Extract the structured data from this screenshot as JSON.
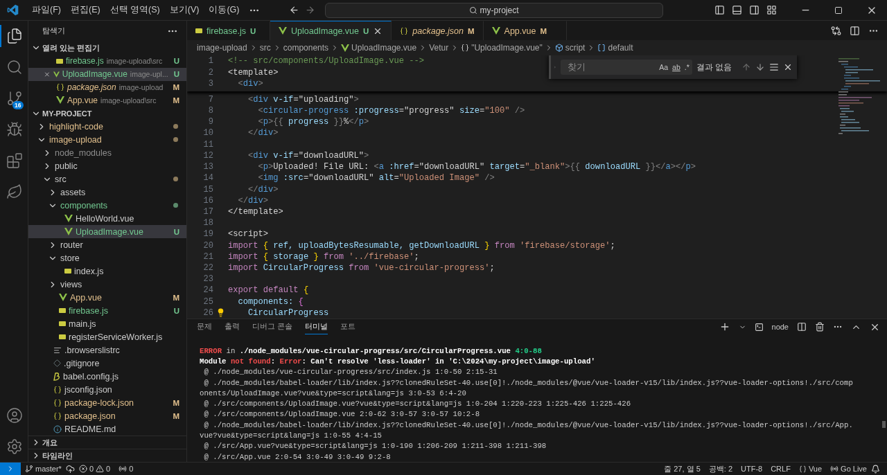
{
  "title_bar": {
    "menu": [
      "파일(F)",
      "편집(E)",
      "선택 영역(S)",
      "보기(V)",
      "이동(G)"
    ],
    "command_center": "my-project"
  },
  "activity_bar": {
    "top": [
      {
        "kind": "explorer",
        "selected": true
      },
      {
        "kind": "search",
        "selected": false
      },
      {
        "kind": "scm",
        "selected": false,
        "badge": "16"
      },
      {
        "kind": "debug",
        "selected": false
      },
      {
        "kind": "extensions",
        "selected": false
      },
      {
        "kind": "leaf",
        "selected": false
      }
    ],
    "bottom": [
      {
        "kind": "account",
        "selected": false
      },
      {
        "kind": "settings",
        "selected": false
      }
    ]
  },
  "sidebar": {
    "title": "탐색기",
    "open_editors": {
      "title": "열려 있는 편집기",
      "expanded": true,
      "items": [
        {
          "name": "firebase.js",
          "path": "image-upload\\src",
          "kind": "js",
          "color": "#73c991",
          "badge": "U",
          "selected": false,
          "preview": false
        },
        {
          "name": "UploadImage.vue",
          "path": "image-upl...",
          "kind": "vue",
          "color": "#73c991",
          "badge": "U",
          "selected": true,
          "preview": false
        },
        {
          "name": "package.json",
          "path": "image-upload",
          "kind": "json",
          "color": "#e2c08d",
          "badge": "M",
          "selected": false,
          "preview": true
        },
        {
          "name": "App.vue",
          "path": "image-upload\\src",
          "kind": "vue",
          "color": "#e2c08d",
          "badge": "M",
          "selected": false,
          "preview": false
        }
      ]
    },
    "project": {
      "title": "MY-PROJECT",
      "expanded": true,
      "items": [
        {
          "name": "highlight-code",
          "kind": "folder",
          "color": "#e2c08d",
          "expanded": false,
          "selected": false,
          "dot": {
            "color": "#8c7a5b"
          }
        },
        {
          "name": "image-upload",
          "kind": "folder",
          "color": "#e2c08d",
          "expanded": true,
          "selected": false,
          "dot": {
            "color": "#8c7a5b"
          },
          "children": [
            {
              "name": "node_modules",
              "kind": "folder",
              "color": "#8c8c8c",
              "expanded": false,
              "selected": false
            },
            {
              "name": "public",
              "kind": "folder",
              "color": "#cccccc",
              "expanded": false,
              "selected": false
            },
            {
              "name": "src",
              "kind": "folder",
              "color": "#cccccc",
              "expanded": true,
              "selected": false,
              "dot": {
                "color": "#8c7a5b"
              },
              "children": [
                {
                  "name": "assets",
                  "kind": "folder",
                  "color": "#cccccc",
                  "expanded": false,
                  "selected": false
                },
                {
                  "name": "components",
                  "kind": "folder",
                  "color": "#73c991",
                  "expanded": true,
                  "selected": false,
                  "dot": {
                    "color": "#5b8a6b"
                  },
                  "children": [
                    {
                      "name": "HelloWorld.vue",
                      "kind": "vue",
                      "color": "#cccccc",
                      "selected": false
                    },
                    {
                      "name": "UploadImage.vue",
                      "kind": "vue",
                      "color": "#73c991",
                      "badge": "U",
                      "selected": true
                    }
                  ]
                },
                {
                  "name": "router",
                  "kind": "folder",
                  "color": "#cccccc",
                  "expanded": false,
                  "selected": false
                },
                {
                  "name": "store",
                  "kind": "folder",
                  "color": "#cccccc",
                  "expanded": true,
                  "selected": false,
                  "children": [
                    {
                      "name": "index.js",
                      "kind": "js",
                      "color": "#cccccc",
                      "selected": false
                    }
                  ]
                },
                {
                  "name": "views",
                  "kind": "folder",
                  "color": "#cccccc",
                  "expanded": false,
                  "selected": false
                },
                {
                  "name": "App.vue",
                  "kind": "vue",
                  "color": "#e2c08d",
                  "badge": "M",
                  "selected": false
                },
                {
                  "name": "firebase.js",
                  "kind": "js",
                  "color": "#73c991",
                  "badge": "U",
                  "selected": false
                },
                {
                  "name": "main.js",
                  "kind": "js",
                  "color": "#cccccc",
                  "selected": false
                },
                {
                  "name": "registerServiceWorker.js",
                  "kind": "js",
                  "color": "#cccccc",
                  "selected": false
                }
              ]
            },
            {
              "name": ".browserslistrc",
              "kind": "list",
              "color": "#cccccc",
              "selected": false
            },
            {
              "name": ".gitignore",
              "kind": "git",
              "color": "#cccccc",
              "selected": false
            },
            {
              "name": "babel.config.js",
              "kind": "babel",
              "color": "#cccccc",
              "selected": false
            },
            {
              "name": "jsconfig.json",
              "kind": "json",
              "color": "#cccccc",
              "selected": false
            },
            {
              "name": "package-lock.json",
              "kind": "json",
              "color": "#e2c08d",
              "badge": "M",
              "selected": false
            },
            {
              "name": "package.json",
              "kind": "json",
              "color": "#e2c08d",
              "badge": "M",
              "selected": false
            },
            {
              "name": "README.md",
              "kind": "info",
              "color": "#cccccc",
              "selected": false
            }
          ]
        }
      ]
    },
    "collapsed_sections": [
      {
        "title": "개요",
        "expanded": false
      },
      {
        "title": "타임라인",
        "expanded": false
      }
    ]
  },
  "editor": {
    "tabs": [
      {
        "label": "firebase.js",
        "kind": "js",
        "color": "#73c991",
        "badge": "U",
        "selected": false,
        "preview": false
      },
      {
        "label": "UploadImage.vue",
        "kind": "vue",
        "color": "#73c991",
        "badge": "U",
        "selected": true,
        "preview": false
      },
      {
        "label": "package.json",
        "kind": "json",
        "color": "#e2c08d",
        "badge": "M",
        "selected": false,
        "preview": true
      },
      {
        "label": "App.vue",
        "kind": "vue",
        "color": "#e2c08d",
        "badge": "M",
        "selected": false,
        "preview": false
      }
    ],
    "breadcrumb": [
      {
        "label": "image-upload",
        "kind": "text"
      },
      {
        "label": "src",
        "kind": "text"
      },
      {
        "label": "components",
        "kind": "text"
      },
      {
        "label": "UploadImage.vue",
        "kind": "vue"
      },
      {
        "label": "Vetur",
        "kind": "text"
      },
      {
        "label": "\"UploadImage.vue\"",
        "kind": "braces"
      },
      {
        "label": "script",
        "kind": "module"
      },
      {
        "label": "default",
        "kind": "field"
      }
    ],
    "find": {
      "placeholder": "찾기",
      "options": [
        "Aa",
        "ab",
        ".*"
      ],
      "result": "결과 없음"
    },
    "sticky_lines": [
      {
        "number": "1",
        "tokens": [
          {
            "text": "<!-- src/components/UploadImage.vue -->",
            "kind": "comment"
          }
        ]
      },
      {
        "number": "2",
        "tokens": [
          {
            "text": "<template>",
            "kind": "text"
          }
        ]
      },
      {
        "number": "3",
        "tokens": [
          {
            "text": "  <",
            "kind": "punct"
          },
          {
            "text": "div",
            "kind": "tag"
          },
          {
            "text": ">",
            "kind": "punct"
          }
        ]
      }
    ],
    "lines": [
      {
        "number": "7",
        "tokens": [
          {
            "text": "    <",
            "kind": "punct"
          },
          {
            "text": "div",
            "kind": "tag"
          },
          {
            "text": " v-if",
            "kind": "attr"
          },
          {
            "text": "=\"uploading\"",
            "kind": "text"
          },
          {
            "text": ">",
            "kind": "punct"
          }
        ]
      },
      {
        "number": "8",
        "tokens": [
          {
            "text": "      <",
            "kind": "punct"
          },
          {
            "text": "circular-progress",
            "kind": "tag"
          },
          {
            "text": " :progress",
            "kind": "attr"
          },
          {
            "text": "=\"progress\"",
            "kind": "text"
          },
          {
            "text": " size",
            "kind": "attr"
          },
          {
            "text": "=",
            "kind": "text"
          },
          {
            "text": "\"100\"",
            "kind": "str"
          },
          {
            "text": " />",
            "kind": "punct"
          }
        ]
      },
      {
        "number": "9",
        "tokens": [
          {
            "text": "      <",
            "kind": "punct"
          },
          {
            "text": "p",
            "kind": "tag"
          },
          {
            "text": ">{{ ",
            "kind": "punct"
          },
          {
            "text": "progress",
            "kind": "var"
          },
          {
            "text": " }}",
            "kind": "punct"
          },
          {
            "text": "%",
            "kind": "text"
          },
          {
            "text": "</",
            "kind": "punct"
          },
          {
            "text": "p",
            "kind": "tag"
          },
          {
            "text": ">",
            "kind": "punct"
          }
        ]
      },
      {
        "number": "10",
        "tokens": [
          {
            "text": "    </",
            "kind": "punct"
          },
          {
            "text": "div",
            "kind": "tag"
          },
          {
            "text": ">",
            "kind": "punct"
          }
        ]
      },
      {
        "number": "11"
      },
      {
        "number": "12",
        "tokens": [
          {
            "text": "    <",
            "kind": "punct"
          },
          {
            "text": "div",
            "kind": "tag"
          },
          {
            "text": " v-if",
            "kind": "attr"
          },
          {
            "text": "=\"downloadURL\"",
            "kind": "text"
          },
          {
            "text": ">",
            "kind": "punct"
          }
        ]
      },
      {
        "number": "13",
        "tokens": [
          {
            "text": "      <",
            "kind": "punct"
          },
          {
            "text": "p",
            "kind": "tag"
          },
          {
            "text": ">",
            "kind": "punct"
          },
          {
            "text": "Uploaded! File URL: ",
            "kind": "text"
          },
          {
            "text": "<",
            "kind": "punct"
          },
          {
            "text": "a",
            "kind": "tag"
          },
          {
            "text": " :href",
            "kind": "attr"
          },
          {
            "text": "=\"downloadURL\"",
            "kind": "text"
          },
          {
            "text": " target",
            "kind": "attr"
          },
          {
            "text": "=",
            "kind": "text"
          },
          {
            "text": "\"_blank\"",
            "kind": "str"
          },
          {
            "text": ">{{ ",
            "kind": "punct"
          },
          {
            "text": "downloadURL",
            "kind": "var"
          },
          {
            "text": " }}</",
            "kind": "punct"
          },
          {
            "text": "a",
            "kind": "tag"
          },
          {
            "text": "></",
            "kind": "punct"
          },
          {
            "text": "p",
            "kind": "tag"
          },
          {
            "text": ">",
            "kind": "punct"
          }
        ]
      },
      {
        "number": "14",
        "tokens": [
          {
            "text": "      <",
            "kind": "punct"
          },
          {
            "text": "img",
            "kind": "tag"
          },
          {
            "text": " :src",
            "kind": "attr"
          },
          {
            "text": "=\"downloadURL\"",
            "kind": "text"
          },
          {
            "text": " alt",
            "kind": "attr"
          },
          {
            "text": "=",
            "kind": "text"
          },
          {
            "text": "\"Uploaded Image\"",
            "kind": "str"
          },
          {
            "text": " />",
            "kind": "punct"
          }
        ]
      },
      {
        "number": "15",
        "tokens": [
          {
            "text": "    </",
            "kind": "punct"
          },
          {
            "text": "div",
            "kind": "tag"
          },
          {
            "text": ">",
            "kind": "punct"
          }
        ]
      },
      {
        "number": "16",
        "tokens": [
          {
            "text": "  </",
            "kind": "punct"
          },
          {
            "text": "div",
            "kind": "tag"
          },
          {
            "text": ">",
            "kind": "punct"
          }
        ]
      },
      {
        "number": "17",
        "tokens": [
          {
            "text": "</template>",
            "kind": "text"
          }
        ]
      },
      {
        "number": "18"
      },
      {
        "number": "19",
        "tokens": [
          {
            "text": "<script>",
            "kind": "text"
          }
        ]
      },
      {
        "number": "20",
        "tokens": [
          {
            "text": "import ",
            "kind": "kw"
          },
          {
            "text": "{",
            "kind": "b1"
          },
          {
            "text": " ref, uploadBytesResumable, getDownloadURL ",
            "kind": "var"
          },
          {
            "text": "}",
            "kind": "b1"
          },
          {
            "text": " from ",
            "kind": "kw"
          },
          {
            "text": "'firebase/storage'",
            "kind": "str"
          },
          {
            "text": ";",
            "kind": "text"
          }
        ]
      },
      {
        "number": "21",
        "tokens": [
          {
            "text": "import ",
            "kind": "kw"
          },
          {
            "text": "{",
            "kind": "b1"
          },
          {
            "text": " storage ",
            "kind": "var"
          },
          {
            "text": "}",
            "kind": "b1"
          },
          {
            "text": " from ",
            "kind": "kw"
          },
          {
            "text": "'../firebase'",
            "kind": "str"
          },
          {
            "text": ";",
            "kind": "text"
          }
        ]
      },
      {
        "number": "22",
        "tokens": [
          {
            "text": "import ",
            "kind": "kw"
          },
          {
            "text": "CircularProgress ",
            "kind": "var"
          },
          {
            "text": "from ",
            "kind": "kw"
          },
          {
            "text": "'vue-circular-progress'",
            "kind": "str"
          },
          {
            "text": ";",
            "kind": "text"
          }
        ]
      },
      {
        "number": "23"
      },
      {
        "number": "24",
        "tokens": [
          {
            "text": "export default ",
            "kind": "kw"
          },
          {
            "text": "{",
            "kind": "b1"
          }
        ]
      },
      {
        "number": "25",
        "tokens": [
          {
            "text": "  components: ",
            "kind": "var"
          },
          {
            "text": "{",
            "kind": "b2"
          }
        ]
      },
      {
        "number": "26",
        "bulb": true,
        "tokens": [
          {
            "text": "    CircularProgress",
            "kind": "var"
          }
        ]
      }
    ]
  },
  "panel": {
    "tabs": [
      {
        "label": "문제",
        "selected": false
      },
      {
        "label": "출력",
        "selected": false
      },
      {
        "label": "디버그 콘솔",
        "selected": false
      },
      {
        "label": "터미널",
        "selected": true
      },
      {
        "label": "포트",
        "selected": false
      }
    ],
    "terminal_name": "node",
    "lines": [
      [
        {
          "text": "ERROR",
          "kind": "err"
        },
        {
          "text": " in ",
          "kind": "text"
        },
        {
          "text": "./node_modules/vue-circular-progress/src/CircularProgress.vue",
          "kind": "bold"
        },
        {
          "text": " 4:0-88",
          "kind": "ok"
        }
      ],
      [
        {
          "text": "Module ",
          "kind": "bold"
        },
        {
          "text": "not found",
          "kind": "err"
        },
        {
          "text": ": ",
          "kind": "bold"
        },
        {
          "text": "Error",
          "kind": "err"
        },
        {
          "text": ": Can't resolve 'less-loader' in 'C:\\2024\\my-project\\image-upload'",
          "kind": "bold"
        }
      ],
      [
        {
          "text": " @ ./node_modules/vue-circular-progress/src/index.js 1:0-50 2:15-31",
          "kind": "text"
        }
      ],
      [
        {
          "text": " @ ./node_modules/babel-loader/lib/index.js??clonedRuleSet-40.use[0]!./node_modules/@vue/vue-loader-v15/lib/index.js??vue-loader-options!./src/comp",
          "kind": "text"
        }
      ],
      [
        {
          "text": "onents/UploadImage.vue?vue&type=script&lang=js 3:0-53 6:4-20",
          "kind": "text"
        }
      ],
      [
        {
          "text": " @ ./src/components/UploadImage.vue?vue&type=script&lang=js 1:0-204 1:220-223 1:225-426 1:225-426",
          "kind": "text"
        }
      ],
      [
        {
          "text": " @ ./src/components/UploadImage.vue 2:0-62 3:0-57 3:0-57 10:2-8",
          "kind": "text"
        }
      ],
      [
        {
          "text": " @ ./node_modules/babel-loader/lib/index.js??clonedRuleSet-40.use[0]!./node_modules/@vue/vue-loader-v15/lib/index.js??vue-loader-options!./src/App.",
          "kind": "text"
        }
      ],
      [
        {
          "text": "vue?vue&type=script&lang=js 1:0-55 4:4-15",
          "kind": "text"
        }
      ],
      [
        {
          "text": " @ ./src/App.vue?vue&type=script&lang=js 1:0-190 1:206-209 1:211-398 1:211-398",
          "kind": "text"
        }
      ],
      [
        {
          "text": " @ ./src/App.vue 2:0-54 3:0-49 3:0-49 9:2-8",
          "kind": "text"
        }
      ]
    ]
  },
  "status_bar": {
    "branch": "master*",
    "errors": "0",
    "warnings": "0",
    "ports": "0",
    "items": [
      "줄 27, 열 5",
      "공백: 2",
      "UTF-8",
      "CRLF"
    ],
    "language": "Vue",
    "live": "Go Live"
  }
}
